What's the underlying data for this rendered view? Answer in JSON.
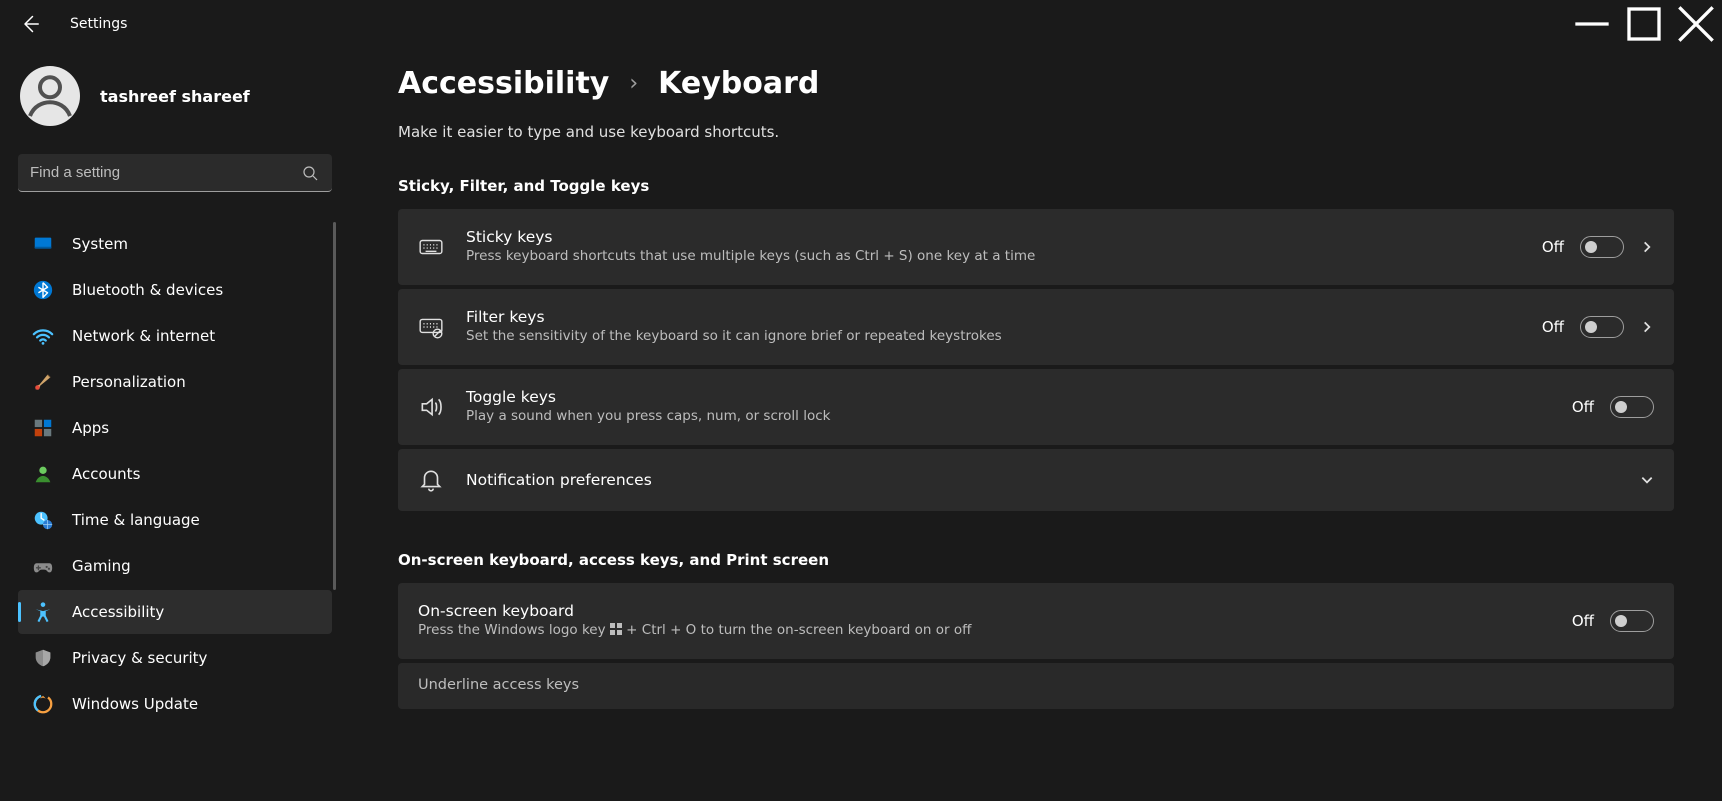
{
  "app_title": "Settings",
  "user": {
    "name": "tashreef shareef"
  },
  "search": {
    "placeholder": "Find a setting"
  },
  "nav": {
    "items": [
      {
        "label": "System"
      },
      {
        "label": "Bluetooth & devices"
      },
      {
        "label": "Network & internet"
      },
      {
        "label": "Personalization"
      },
      {
        "label": "Apps"
      },
      {
        "label": "Accounts"
      },
      {
        "label": "Time & language"
      },
      {
        "label": "Gaming"
      },
      {
        "label": "Accessibility"
      },
      {
        "label": "Privacy & security"
      },
      {
        "label": "Windows Update"
      }
    ],
    "active_index": 8
  },
  "breadcrumb": {
    "parent": "Accessibility",
    "current": "Keyboard"
  },
  "subtitle": "Make it easier to type and use keyboard shortcuts.",
  "sections": [
    {
      "header": "Sticky, Filter, and Toggle keys",
      "cards": [
        {
          "title": "Sticky keys",
          "desc": "Press keyboard shortcuts that use multiple keys (such as Ctrl + S) one key at a time",
          "toggle_state": "Off",
          "has_chevron": true
        },
        {
          "title": "Filter keys",
          "desc": "Set the sensitivity of the keyboard so it can ignore brief or repeated keystrokes",
          "toggle_state": "Off",
          "has_chevron": true
        },
        {
          "title": "Toggle keys",
          "desc": "Play a sound when you press caps, num, or scroll lock",
          "toggle_state": "Off",
          "has_chevron": false
        },
        {
          "title": "Notification preferences",
          "expandable": true
        }
      ]
    },
    {
      "header": "On-screen keyboard, access keys, and Print screen",
      "cards": [
        {
          "title": "On-screen keyboard",
          "desc_prefix": "Press the Windows logo key ",
          "desc_suffix": " + Ctrl + O to turn the on-screen keyboard on or off",
          "toggle_state": "Off",
          "no_icon": true
        },
        {
          "title": "Underline access keys",
          "partial": true
        }
      ]
    }
  ]
}
